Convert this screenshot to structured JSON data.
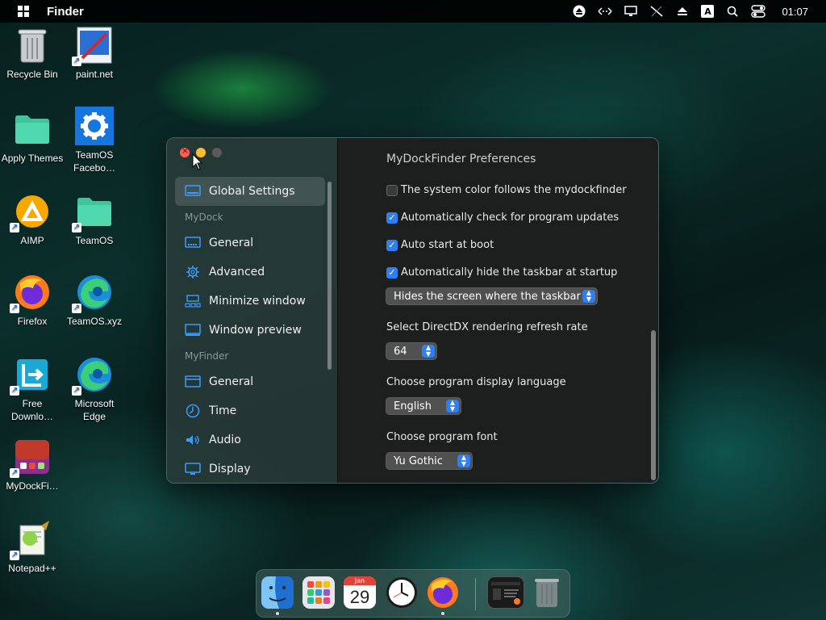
{
  "menubar": {
    "app_name": "Finder",
    "clock": "01:07",
    "input_indicator": "A",
    "tray_icons": [
      "eject-circle-icon",
      "network-arrows-icon",
      "display-icon",
      "network-off-icon",
      "eject-icon",
      "input-method-icon",
      "search-icon",
      "control-center-icon"
    ]
  },
  "desktop": {
    "icons": [
      {
        "label": "Recycle Bin",
        "icon": "recycle-bin-icon"
      },
      {
        "label": "paint.net",
        "icon": "paint-net-icon"
      },
      {
        "label": "Apply Themes",
        "icon": "folder-icon"
      },
      {
        "label": "TeamOS Facebo…",
        "icon": "gear-icon"
      },
      {
        "label": "AIMP",
        "icon": "aimp-icon"
      },
      {
        "label": "TeamOS",
        "icon": "folder-icon"
      },
      {
        "label": "Firefox",
        "icon": "firefox-icon"
      },
      {
        "label": "TeamOS.xyz",
        "icon": "edge-icon"
      },
      {
        "label": "Free Downlo…",
        "icon": "download-manager-icon"
      },
      {
        "label": "Microsoft Edge",
        "icon": "edge-icon"
      },
      {
        "label": "MyDockFi…",
        "icon": "mydockfinder-icon"
      },
      {
        "label": "Notepad++",
        "icon": "notepad-plus-plus-icon"
      }
    ]
  },
  "window": {
    "title": "MyDockFinder Preferences",
    "sidebar": {
      "items": [
        {
          "type": "item",
          "label": "Global Settings",
          "icon": "monitor-icon",
          "active": true
        },
        {
          "type": "section",
          "label": "MyDock"
        },
        {
          "type": "item",
          "label": "General",
          "icon": "dock-icon"
        },
        {
          "type": "item",
          "label": "Advanced",
          "icon": "gear-icon"
        },
        {
          "type": "item",
          "label": "Minimize window",
          "icon": "minimize-window-icon"
        },
        {
          "type": "item",
          "label": "Window preview",
          "icon": "window-preview-icon"
        },
        {
          "type": "section",
          "label": "MyFinder"
        },
        {
          "type": "item",
          "label": "General",
          "icon": "menubar-icon"
        },
        {
          "type": "item",
          "label": "Time",
          "icon": "clock-icon"
        },
        {
          "type": "item",
          "label": "Audio",
          "icon": "speaker-icon"
        },
        {
          "type": "item",
          "label": "Display",
          "icon": "display-icon"
        }
      ]
    },
    "options": [
      {
        "label": "The system color follows the mydockfinder",
        "checked": false
      },
      {
        "label": "Automatically check for program updates",
        "checked": true
      },
      {
        "label": "Auto start at boot",
        "checked": true
      },
      {
        "label": "Automatically hide the taskbar at startup",
        "checked": true
      }
    ],
    "taskbar_mode": {
      "value": "Hides the screen where the taskbar"
    },
    "refresh_rate": {
      "label": "Select DirectDX rendering refresh rate",
      "value": "64"
    },
    "language": {
      "label": "Choose program display language",
      "value": "English"
    },
    "font": {
      "label": "Choose program font",
      "value": "Yu Gothic"
    }
  },
  "dock": {
    "calendar_month": "Jan",
    "calendar_day": "29",
    "items": [
      "finder-icon",
      "launchpad-icon",
      "calendar-icon",
      "clock-icon",
      "firefox-icon",
      "mydockfinder-preview-icon",
      "trash-icon"
    ]
  },
  "colors": {
    "accent": "#2f7ff0",
    "close": "#ff5f57",
    "minimize": "#febc2e"
  }
}
